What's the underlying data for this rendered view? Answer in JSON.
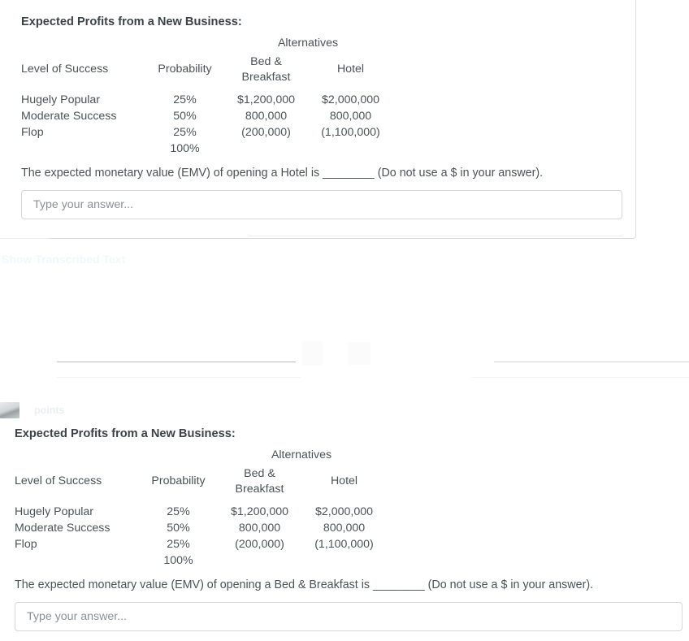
{
  "page": {
    "title": "Expected Profits from a New Business quiz",
    "background_color": "#ffffff",
    "text_color": "#4b5357"
  },
  "table_header": {
    "alternatives_label": "Alternatives",
    "level_of_success": "Level of Success",
    "probability": "Probability",
    "bed_and_breakfast_line1": "Bed &",
    "bed_and_breakfast_line2": "Breakfast",
    "hotel": "Hotel"
  },
  "table_rows": [
    {
      "level": "Hugely Popular",
      "probability": "25%",
      "bed_breakfast": "$1,200,000",
      "hotel": "$2,000,000"
    },
    {
      "level": "Moderate Success",
      "probability": "50%",
      "bed_breakfast": "800,000",
      "hotel": "800,000"
    },
    {
      "level": "Flop",
      "probability": "25%",
      "bed_breakfast": "(200,000)",
      "hotel": "(1,100,000)"
    }
  ],
  "table_total": {
    "level": "",
    "probability": "100%",
    "bed_breakfast": "",
    "hotel": ""
  },
  "question_top": {
    "heading": "Expected Profits from a New Business:",
    "prompt": "The expected monetary value (EMV) of opening a Hotel is ________ (Do not use a $ in your answer).",
    "answer_value": "",
    "answer_placeholder": "Type your answer..."
  },
  "question_bottom": {
    "heading": "Expected Profits from a New Business:",
    "prompt": "The expected monetary value (EMV) of opening a Bed & Breakfast is ________ (Do not use a $ in your answer).",
    "answer_value": "",
    "answer_placeholder": "Type your answer..."
  },
  "faded_region": {
    "show_transcribed_text": "Show Transcribed Text",
    "points_label": "points",
    "thumbnail_icon": "image-thumbnail-icon"
  }
}
